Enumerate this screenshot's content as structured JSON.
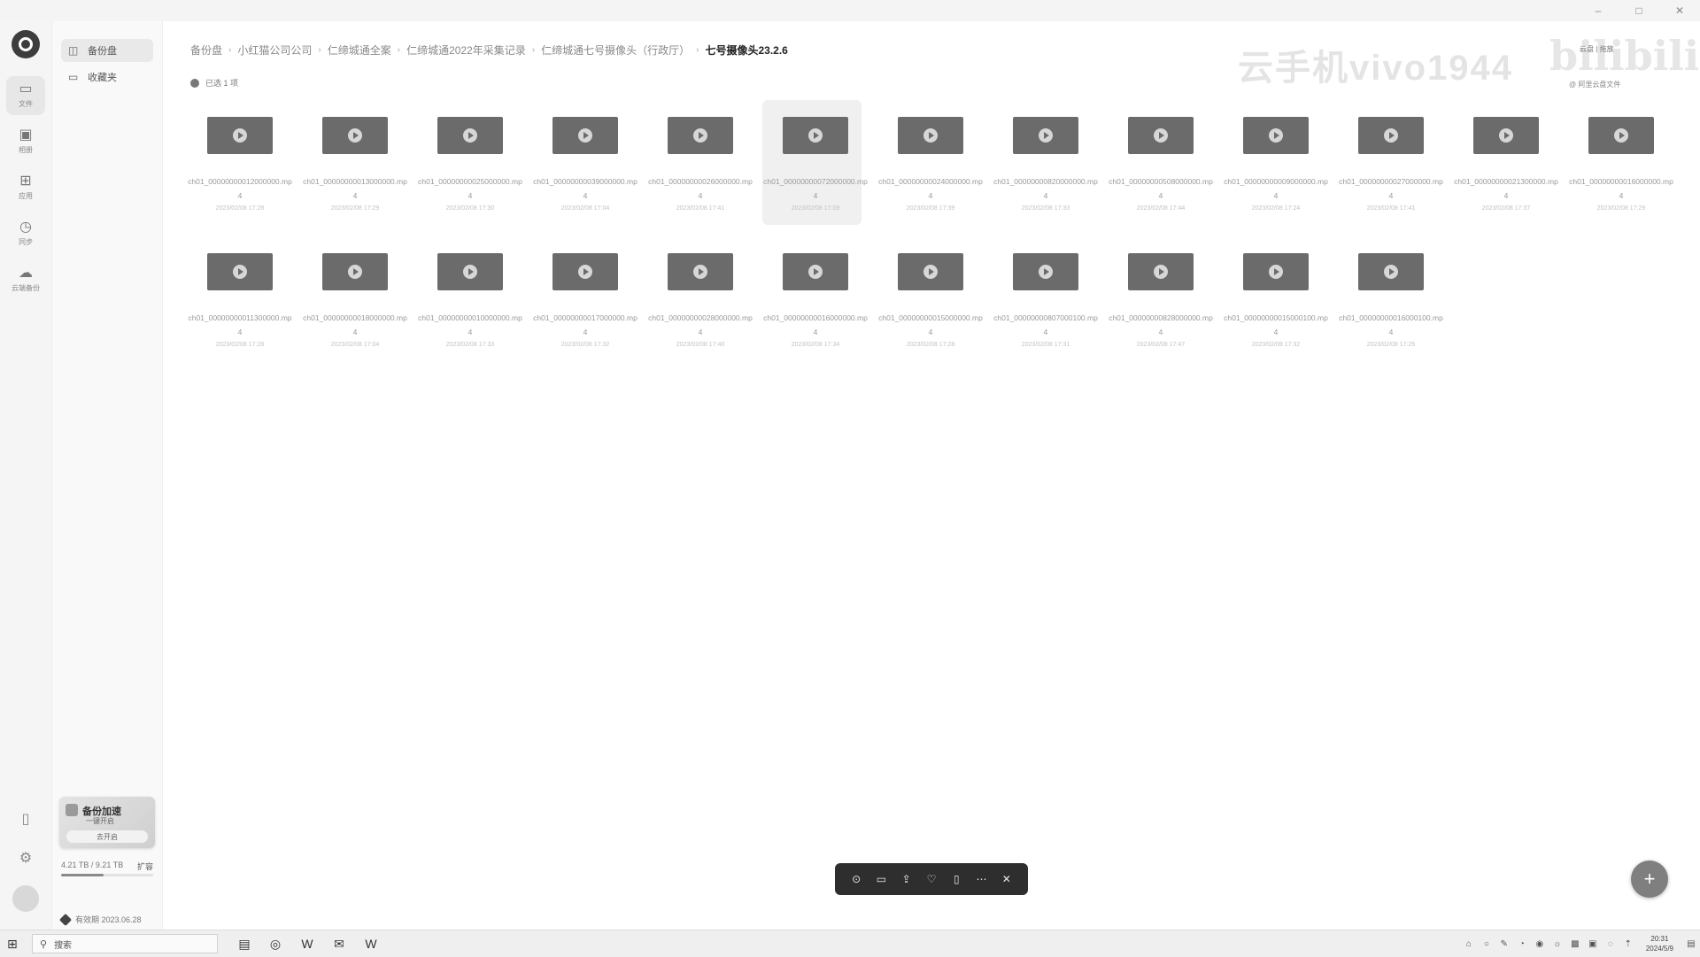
{
  "window": {
    "controls": [
      "–",
      "□",
      "✕"
    ]
  },
  "rail": {
    "items": [
      {
        "icon": "folder-icon",
        "glyph": "▭",
        "label": "文件"
      },
      {
        "icon": "image-icon",
        "glyph": "▣",
        "label": "相册"
      },
      {
        "icon": "apps-icon",
        "glyph": "⊞",
        "label": "应用"
      },
      {
        "icon": "clock-icon",
        "glyph": "◷",
        "label": "同步"
      },
      {
        "icon": "cloud-icon",
        "glyph": "☁",
        "label": "云端备份"
      }
    ],
    "bottom": [
      {
        "icon": "phone-icon",
        "glyph": "▯"
      },
      {
        "icon": "settings-icon",
        "glyph": "⚙"
      }
    ]
  },
  "side": {
    "items": [
      {
        "icon": "backup-icon",
        "glyph": "◫",
        "label": "备份盘"
      },
      {
        "icon": "folder-icon",
        "glyph": "▭",
        "label": "收藏夹"
      }
    ],
    "promo": {
      "title": "备份加速",
      "subtitle": "一键开启",
      "button": "去开启"
    },
    "storage": {
      "text": "4.21 TB / 9.21 TB",
      "upgrade": "扩容",
      "fraction": 0.46
    },
    "vip": "有效期 2023.06.28"
  },
  "breadcrumb": [
    "备份盘",
    "小红猫公司公司",
    "仁缔城通全案",
    "仁缔城通2022年采集记录",
    "仁缔城通七号摄像头（行政厅）",
    "七号摄像头23.2.6"
  ],
  "selection_info": "已选 1 项",
  "watermark": {
    "text": "云手机vivo1944",
    "logo": "bilibili",
    "small": "@ 阿里云盘文件",
    "top_right": "云盘 | 拖放"
  },
  "files": [
    {
      "name": "ch01_00000000012000000.mp4",
      "date": "2023/02/08 17:28",
      "selected": false
    },
    {
      "name": "ch01_00000000013000000.mp4",
      "date": "2023/02/08 17:29",
      "selected": false
    },
    {
      "name": "ch01_00000000025000000.mp4",
      "date": "2023/02/08 17:30",
      "selected": false
    },
    {
      "name": "ch01_00000000039000000.mp4",
      "date": "2023/02/08 17:04",
      "selected": false
    },
    {
      "name": "ch01_00000000026000000.mp4",
      "date": "2023/02/08 17:41",
      "selected": false
    },
    {
      "name": "ch01_00000000072000000.mp4",
      "date": "2023/02/08 17:09",
      "selected": true
    },
    {
      "name": "ch01_00000000024000000.mp4",
      "date": "2023/02/08 17:39",
      "selected": false
    },
    {
      "name": "ch01_00000000820000000.mp4",
      "date": "2023/02/08 17:33",
      "selected": false
    },
    {
      "name": "ch01_00000000508000000.mp4",
      "date": "2023/02/08 17:44",
      "selected": false
    },
    {
      "name": "ch01_00000000009000000.mp4",
      "date": "2023/02/08 17:24",
      "selected": false
    },
    {
      "name": "ch01_00000000027000000.mp4",
      "date": "2023/02/08 17:41",
      "selected": false
    },
    {
      "name": "ch01_00000000021300000.mp4",
      "date": "2023/02/08 17:37",
      "selected": false
    },
    {
      "name": "ch01_00000000016000000.mp4",
      "date": "2023/02/08 17:29",
      "selected": false
    },
    {
      "name": "ch01_00000000011300000.mp4",
      "date": "2023/02/08 17:28",
      "selected": false
    },
    {
      "name": "ch01_00000000018000000.mp4",
      "date": "2023/02/08 17:04",
      "selected": false
    },
    {
      "name": "ch01_00000000010000000.mp4",
      "date": "2023/02/08 17:33",
      "selected": false
    },
    {
      "name": "ch01_00000000017000000.mp4",
      "date": "2023/02/08 17:32",
      "selected": false
    },
    {
      "name": "ch01_00000000028000000.mp4",
      "date": "2023/02/08 17:40",
      "selected": false
    },
    {
      "name": "ch01_00000000016000000.mp4",
      "date": "2023/02/08 17:34",
      "selected": false
    },
    {
      "name": "ch01_00000000015000000.mp4",
      "date": "2023/02/08 17:28",
      "selected": false
    },
    {
      "name": "ch01_00000000807000100.mp4",
      "date": "2023/02/08 17:31",
      "selected": false
    },
    {
      "name": "ch01_00000000828000000.mp4",
      "date": "2023/02/08 17:47",
      "selected": false
    },
    {
      "name": "ch01_00000000015000100.mp4",
      "date": "2023/02/08 17:32",
      "selected": false
    },
    {
      "name": "ch01_00000000016000100.mp4",
      "date": "2023/02/08 17:25",
      "selected": false
    }
  ],
  "toolbar": [
    {
      "icon": "download-icon",
      "glyph": "⊙"
    },
    {
      "icon": "move-icon",
      "glyph": "▭"
    },
    {
      "icon": "share-icon",
      "glyph": "⇪"
    },
    {
      "icon": "favorite-icon",
      "glyph": "♡"
    },
    {
      "icon": "delete-icon",
      "glyph": "▯"
    },
    {
      "icon": "more-icon",
      "glyph": "⋯"
    },
    {
      "icon": "close-icon",
      "glyph": "✕"
    }
  ],
  "fab": "+",
  "taskbar": {
    "start_glyph": "⊞",
    "search_placeholder": "搜索",
    "apps": [
      {
        "icon": "file-explorer-icon",
        "glyph": "▤"
      },
      {
        "icon": "browser-icon",
        "glyph": "◎"
      },
      {
        "icon": "wps-icon",
        "glyph": "W"
      },
      {
        "icon": "mail-icon",
        "glyph": "✉"
      },
      {
        "icon": "wps-icon-2",
        "glyph": "W"
      }
    ],
    "tray": [
      "⌂",
      "○",
      "✎",
      "◔",
      "◉",
      "☼",
      "▩",
      "▣",
      "◌",
      "⇡"
    ],
    "time": "20:31",
    "date": "2024/5/9"
  }
}
